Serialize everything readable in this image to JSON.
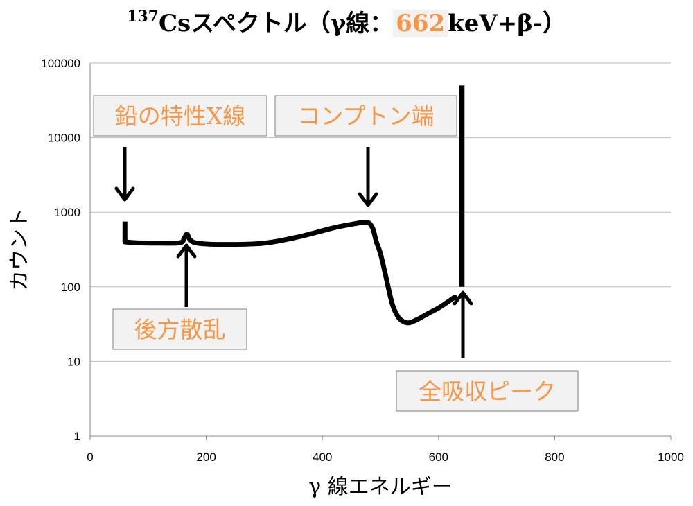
{
  "title": {
    "sup": "137",
    "pre": "Csスペクトル（γ線：",
    "accent": "662",
    "post": "keV+β-）"
  },
  "chart_data": {
    "type": "line",
    "xlabel": "γ 線エネルギー",
    "ylabel": "カウント",
    "xlim": [
      0,
      1000
    ],
    "ylim": [
      1,
      100000
    ],
    "yscale": "log",
    "grid": "horizontal",
    "xticks": [
      "0",
      "200",
      "400",
      "600",
      "800",
      "1000"
    ],
    "yticks": [
      "1",
      "10",
      "100",
      "1000",
      "10000",
      "100000"
    ],
    "line_color": "#000000",
    "series": [
      {
        "x": [
          60,
          80,
          120,
          155,
          162,
          167,
          172,
          185,
          230,
          300,
          360,
          420,
          455,
          470,
          480,
          487,
          493,
          500,
          510,
          520,
          530,
          540,
          550,
          565,
          580,
          600,
          615,
          628
        ],
        "y": [
          400,
          390,
          385,
          390,
          450,
          510,
          430,
          385,
          370,
          385,
          470,
          620,
          700,
          730,
          720,
          600,
          400,
          280,
          130,
          60,
          40,
          34,
          33,
          37,
          43,
          52,
          62,
          73
        ]
      }
    ],
    "edge_spike": {
      "x": 60,
      "y_from": 400,
      "y_to": 750
    },
    "photopeak": {
      "x": 640,
      "y_from": 100,
      "y_to": 50000
    },
    "annotations": [
      {
        "label": "鉛の特性X線",
        "x": 60,
        "arrow": "down"
      },
      {
        "label": "コンプトン端",
        "x": 480,
        "arrow": "down"
      },
      {
        "label": "後方散乱",
        "x": 167,
        "arrow": "up"
      },
      {
        "label": "全吸収ピーク",
        "x": 640,
        "arrow": "up"
      }
    ],
    "annotation_color": "#f79646"
  }
}
